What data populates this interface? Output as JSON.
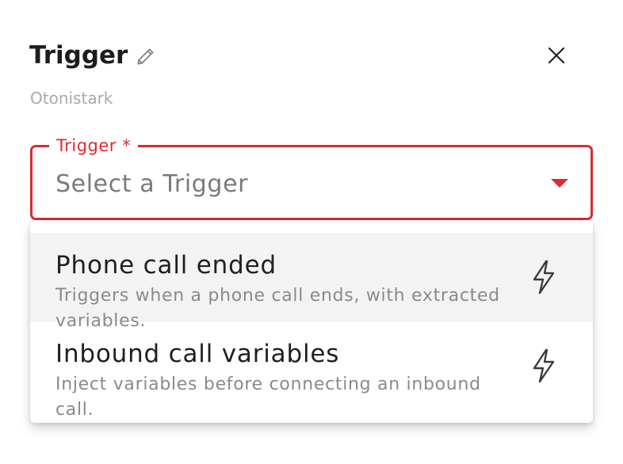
{
  "header": {
    "title": "Trigger",
    "subtitle": "Otonistark",
    "edit_icon": "pencil-icon",
    "close_icon": "close-icon"
  },
  "trigger_select": {
    "label": "Trigger *",
    "value": "Select a Trigger",
    "arrow_icon": "caret-down-icon",
    "accent_color": "#e0292d"
  },
  "dropdown": {
    "options": [
      {
        "title": "Phone call ended",
        "description": "Triggers when a phone call ends, with extracted variables.",
        "icon": "lightning-bolt-icon",
        "highlighted": true
      },
      {
        "title": "Inbound call variables",
        "description": "Inject variables before connecting an inbound call.",
        "icon": "lightning-bolt-icon",
        "highlighted": false
      }
    ]
  }
}
